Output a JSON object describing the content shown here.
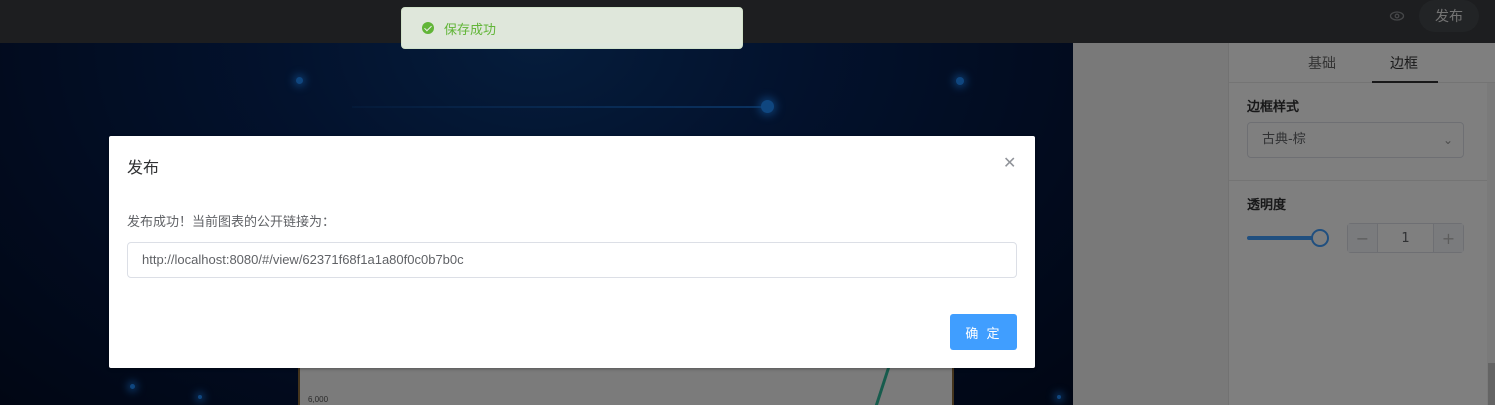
{
  "topbar": {
    "publish_label": "发布",
    "preview_icon": "eye-icon"
  },
  "toast": {
    "message": "保存成功",
    "icon": "success-check-icon"
  },
  "canvas": {
    "chart_tick_label": "6,000"
  },
  "right_panel": {
    "tabs": [
      {
        "label": "基础",
        "active": false
      },
      {
        "label": "边框",
        "active": true
      }
    ],
    "border_style": {
      "label": "边框样式",
      "selected": "古典-棕"
    },
    "opacity": {
      "label": "透明度",
      "slider_value": 1,
      "stepper_value": "1",
      "minus_symbol": "−",
      "plus_symbol": "+"
    }
  },
  "dialog": {
    "title": "发布",
    "message": "发布成功！当前图表的公开链接为：",
    "link_value": "http://localhost:8080/#/view/62371f68f1a1a80f0c0b7b0c",
    "ok_label": "确 定",
    "close_icon": "close-icon"
  },
  "colors": {
    "primary": "#409eff",
    "success": "#67c23a",
    "topbar_bg": "#3a3d40"
  }
}
